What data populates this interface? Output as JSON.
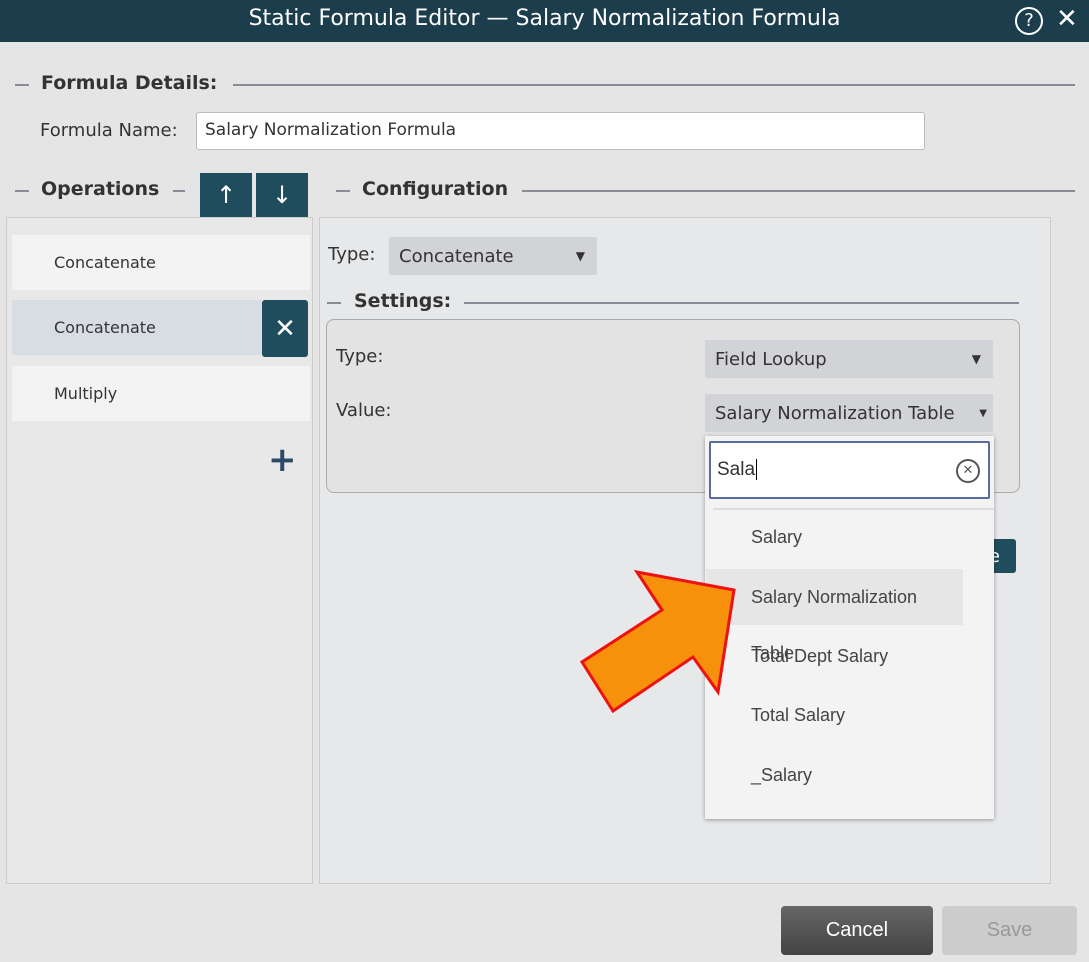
{
  "title": "Static Formula Editor — Salary Normalization Formula",
  "formula_details": {
    "legend": "Formula Details:",
    "name_label": "Formula Name:",
    "name_value": "Salary Normalization Formula"
  },
  "operations": {
    "legend": "Operations",
    "items": [
      {
        "label": "Concatenate"
      },
      {
        "label": "Concatenate",
        "selected": true
      },
      {
        "label": "Multiply"
      }
    ]
  },
  "configuration": {
    "legend": "Configuration",
    "type_label": "Type:",
    "type_value": "Concatenate",
    "settings": {
      "legend": "Settings:",
      "type_label": "Type:",
      "type_value": "Field Lookup",
      "value_label": "Value:",
      "value_value": "Salary Normalization Table"
    },
    "hidden_button_visible_text": "e"
  },
  "dropdown": {
    "search_value": "Sala",
    "options": [
      "Salary",
      "Salary Normalization Table",
      "Total Dept Salary",
      "Total Salary",
      "_Salary"
    ],
    "highlighted": "Salary Normalization Table"
  },
  "footer": {
    "cancel": "Cancel",
    "save": "Save"
  },
  "colors": {
    "header": "#1b3d4c",
    "accent": "#1f4d5e",
    "arrow": "#f7900a",
    "arrow_outline": "#ee1111"
  }
}
